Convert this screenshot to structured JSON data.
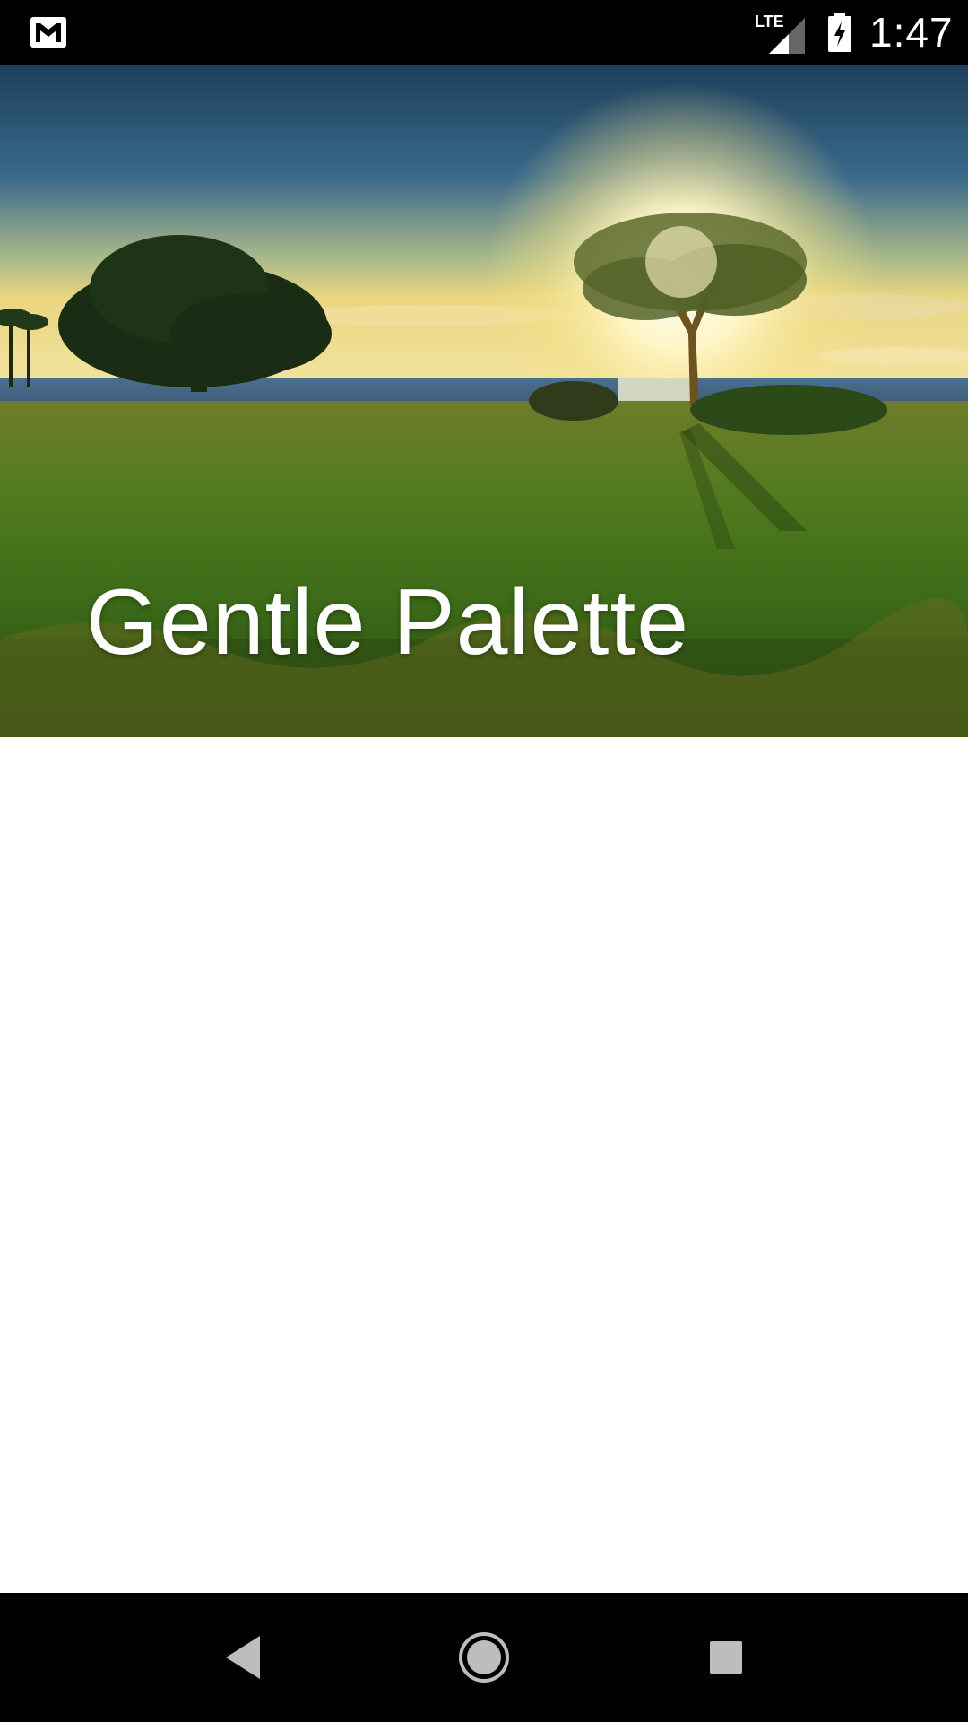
{
  "status_bar": {
    "time": "1:47",
    "network": "LTE",
    "notification_icon": "gmail-icon",
    "battery_state": "charging"
  },
  "header": {
    "title": "Gentle Palette",
    "image": "landscape with trees, sea and sunset over grass field"
  },
  "nav_bar": {
    "back_icon": "back-triangle-icon",
    "home_icon": "home-circle-icon",
    "recents_icon": "recents-square-icon"
  },
  "colors": {
    "status_bar_bg": "#000000",
    "nav_bar_bg": "#000000",
    "content_bg": "#ffffff",
    "title_text": "#ffffff"
  }
}
